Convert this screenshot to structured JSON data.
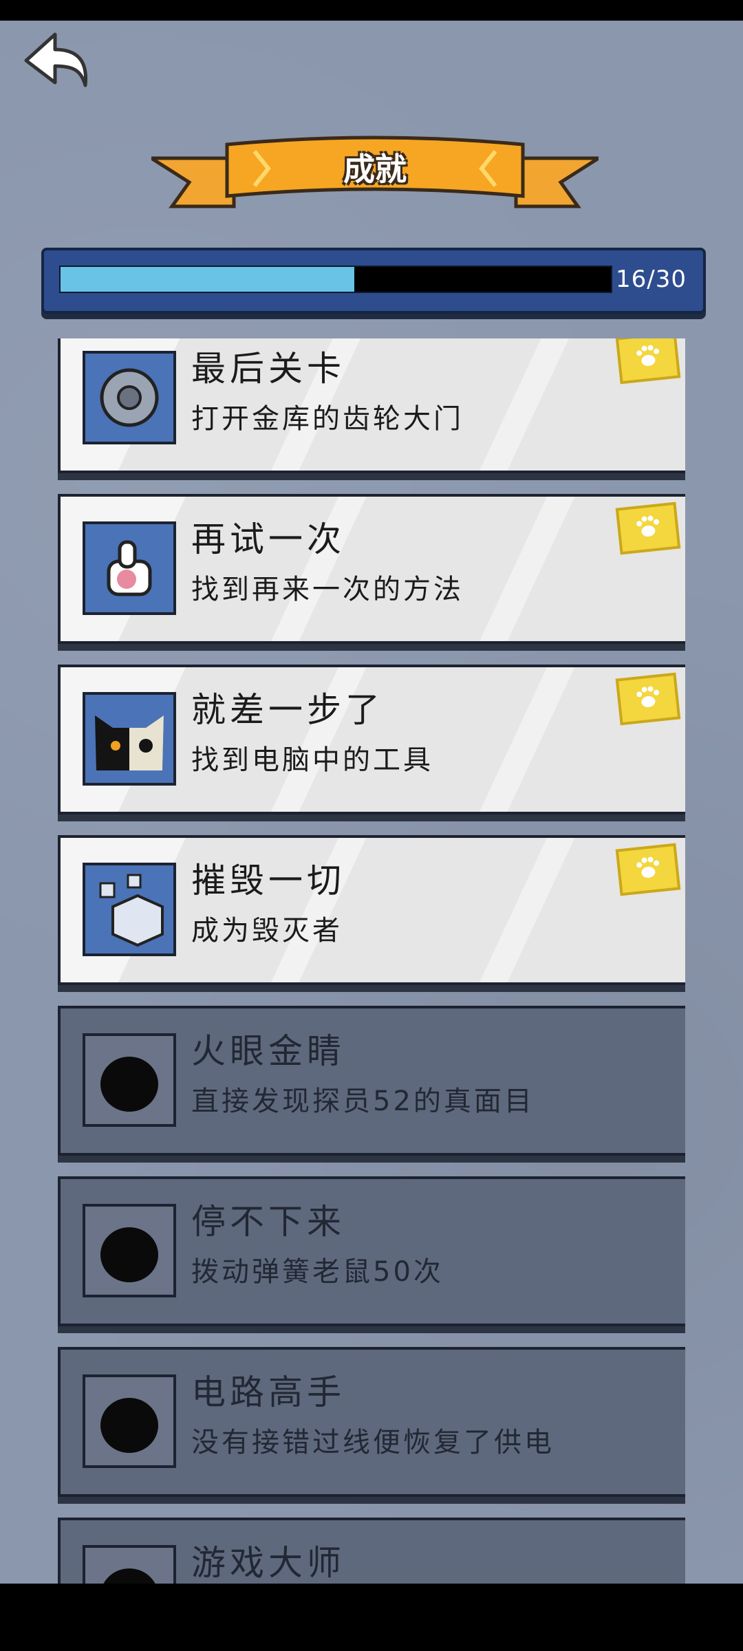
{
  "header": {
    "title": "成就",
    "back_icon": "back-arrow-icon"
  },
  "progress": {
    "text": "16/30",
    "value": 0.5333,
    "fill_color": "#69c3e6"
  },
  "achievements": [
    {
      "title": "最后关卡",
      "desc": "打开金库的齿轮大门",
      "unlocked": true,
      "icon": "vault-gear-icon"
    },
    {
      "title": "再试一次",
      "desc": "找到再来一次的方法",
      "unlocked": true,
      "icon": "thumbs-up-icon"
    },
    {
      "title": "就差一步了",
      "desc": "找到电脑中的工具",
      "unlocked": true,
      "icon": "cat-skull-icon"
    },
    {
      "title": "摧毁一切",
      "desc": "成为毁灭者",
      "unlocked": true,
      "icon": "cubes-icon"
    },
    {
      "title": "火眼金睛",
      "desc": "直接发现探员52的真面目",
      "unlocked": false,
      "icon": "silhouette-agent-icon"
    },
    {
      "title": "停不下来",
      "desc": "拨动弹簧老鼠50次",
      "unlocked": false,
      "icon": "silhouette-mouse-icon"
    },
    {
      "title": "电路高手",
      "desc": "没有接错过线便恢复了供电",
      "unlocked": false,
      "icon": "silhouette-plug-icon"
    },
    {
      "title": "游戏大师",
      "desc": "",
      "unlocked": false,
      "icon": "silhouette-icon"
    }
  ]
}
